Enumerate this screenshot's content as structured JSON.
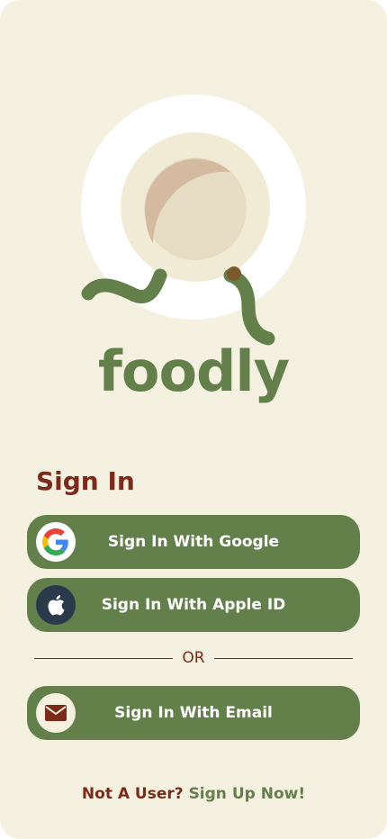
{
  "brand": {
    "name": "foodly"
  },
  "signin": {
    "title": "Sign In"
  },
  "buttons": {
    "google": {
      "label": "Sign In With Google",
      "icon": "google-icon"
    },
    "apple": {
      "label": "Sign In With Apple ID",
      "icon": "apple-icon"
    },
    "email": {
      "label": "Sign In With Email",
      "icon": "mail-icon"
    }
  },
  "divider": {
    "text": "OR"
  },
  "footer": {
    "question": "Not A User?",
    "link": "Sign Up Now!"
  },
  "colors": {
    "background": "#f5f1e0",
    "accent_green": "#63804a",
    "accent_brown": "#7a2b1a",
    "apple_circle": "#2b3a4a"
  }
}
